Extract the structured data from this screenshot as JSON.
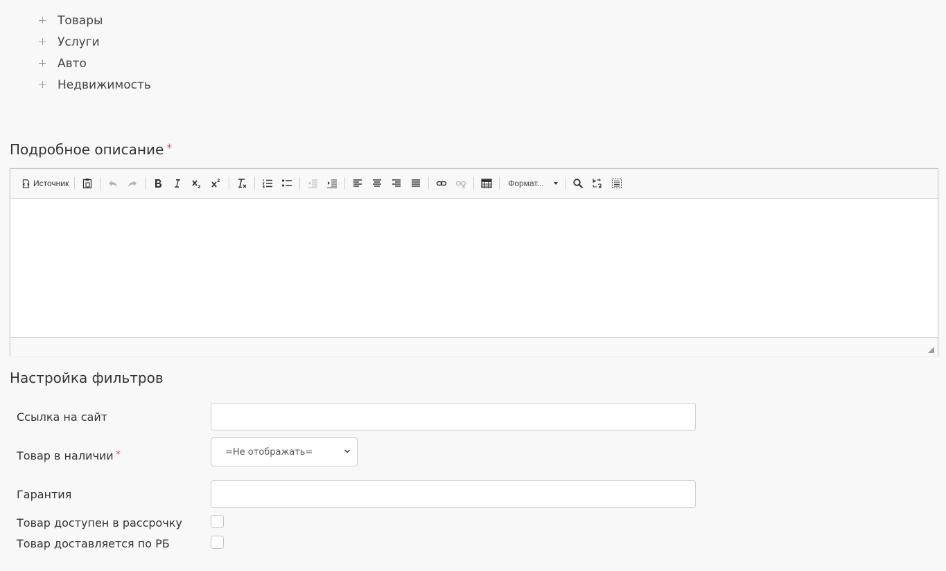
{
  "tree": {
    "items": [
      {
        "label": "Товары"
      },
      {
        "label": "Услуги"
      },
      {
        "label": "Авто"
      },
      {
        "label": "Недвижимость"
      }
    ]
  },
  "description": {
    "title": "Подробное описание",
    "required_mark": "*"
  },
  "editor": {
    "source_label": "Источник",
    "format_label": "Формат...",
    "content": ""
  },
  "filters": {
    "title": "Настройка фильтров",
    "site_link": {
      "label": "Ссылка на сайт",
      "value": ""
    },
    "in_stock": {
      "label": "Товар в наличии",
      "required_mark": "*",
      "selected": "=Не отображать="
    },
    "warranty": {
      "label": "Гарантия",
      "value": ""
    },
    "installment": {
      "label": "Товар доступен в рассрочку",
      "checked": false
    },
    "delivery": {
      "label": "Товар доставляется по РБ",
      "checked": false
    }
  }
}
